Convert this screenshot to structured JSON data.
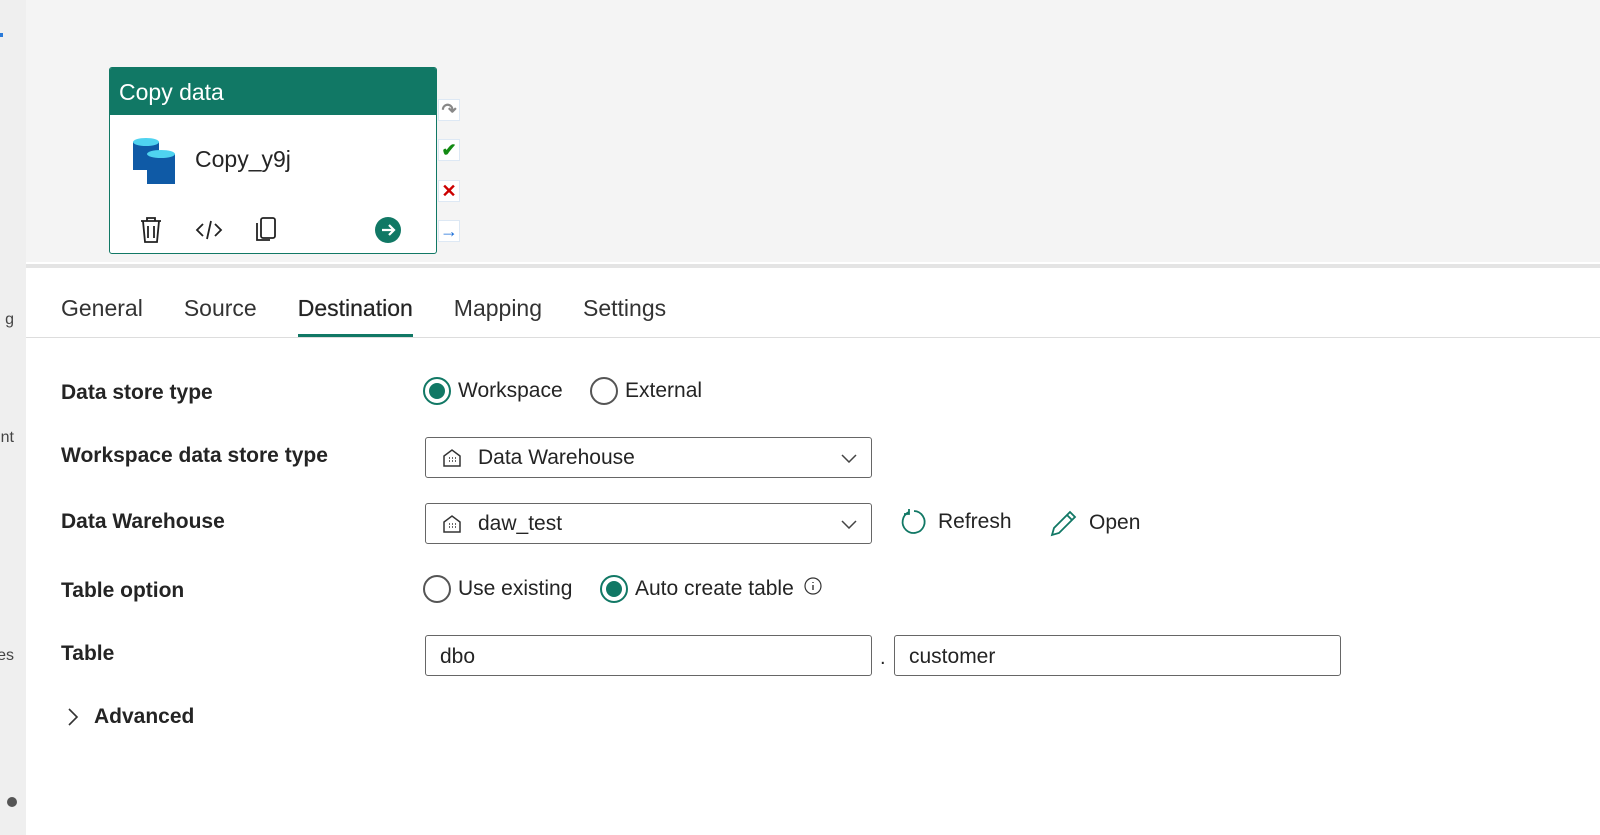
{
  "sidebar": {
    "fragments": [
      "g",
      "nt",
      "es"
    ]
  },
  "activity": {
    "header": "Copy data",
    "name": "Copy_y9j"
  },
  "tabs": [
    {
      "label": "General"
    },
    {
      "label": "Source"
    },
    {
      "label": "Destination"
    },
    {
      "label": "Mapping"
    },
    {
      "label": "Settings"
    }
  ],
  "form": {
    "data_store_type": {
      "label": "Data store type",
      "options": [
        "Workspace",
        "External"
      ],
      "selected": "Workspace"
    },
    "workspace_type": {
      "label": "Workspace data store type",
      "value": "Data Warehouse"
    },
    "warehouse": {
      "label": "Data Warehouse",
      "value": "daw_test",
      "refresh": "Refresh",
      "open": "Open"
    },
    "table_option": {
      "label": "Table option",
      "options": [
        "Use existing",
        "Auto create table"
      ],
      "selected": "Auto create table"
    },
    "table": {
      "label": "Table",
      "schema": "dbo",
      "separator": ".",
      "name": "customer"
    },
    "advanced": "Advanced"
  },
  "colors": {
    "accent": "#117865"
  }
}
